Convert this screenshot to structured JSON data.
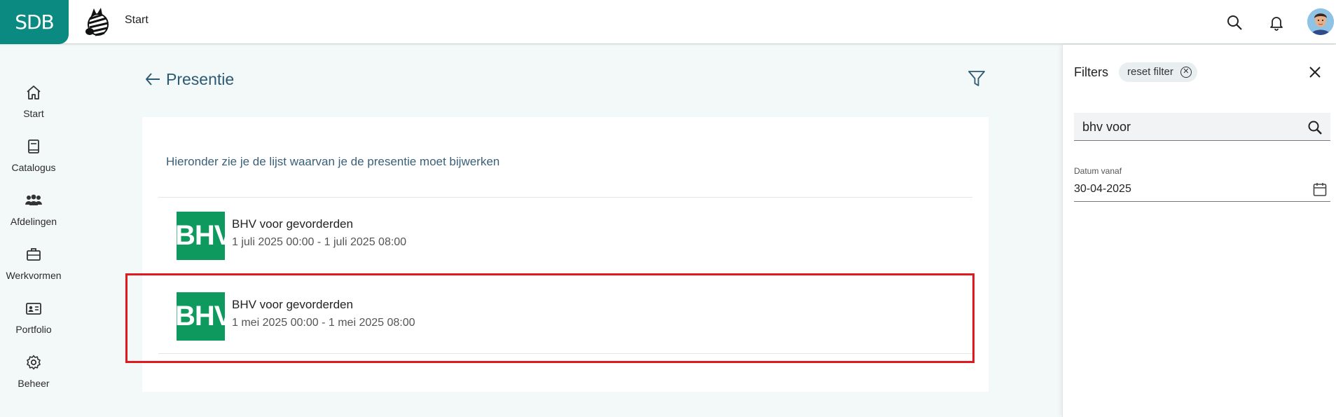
{
  "header": {
    "logo_text": "SDB",
    "breadcrumb": "Start",
    "icons": [
      "search-icon",
      "bell-icon",
      "user-avatar"
    ],
    "brand_color": "#0a8a80"
  },
  "sidebar": {
    "items": [
      {
        "label": "Start",
        "icon": "home-icon"
      },
      {
        "label": "Catalogus",
        "icon": "book-icon"
      },
      {
        "label": "Afdelingen",
        "icon": "people-icon"
      },
      {
        "label": "Werkvormen",
        "icon": "briefcase-icon"
      },
      {
        "label": "Portfolio",
        "icon": "id-card-icon"
      },
      {
        "label": "Beheer",
        "icon": "gear-icon"
      }
    ]
  },
  "main": {
    "title": "Presentie",
    "intro": "Hieronder zie je de lijst waarvan je de presentie moet bijwerken",
    "items": [
      {
        "thumb_text": "BHV",
        "title": "BHV voor gevorderden",
        "dates": "1 juli 2025 00:00 - 1 juli 2025 08:00"
      },
      {
        "thumb_text": "BHV",
        "title": "BHV voor gevorderden",
        "dates": "1 mei 2025 00:00 - 1 mei 2025 08:00"
      }
    ],
    "thumb_color": "#0e9a5e",
    "highlight_color": "#e0191f"
  },
  "filters": {
    "title": "Filters",
    "reset_label": "reset filter",
    "search_value": "bhv voor",
    "date_label": "Datum vanaf",
    "date_value": "30-04-2025"
  }
}
